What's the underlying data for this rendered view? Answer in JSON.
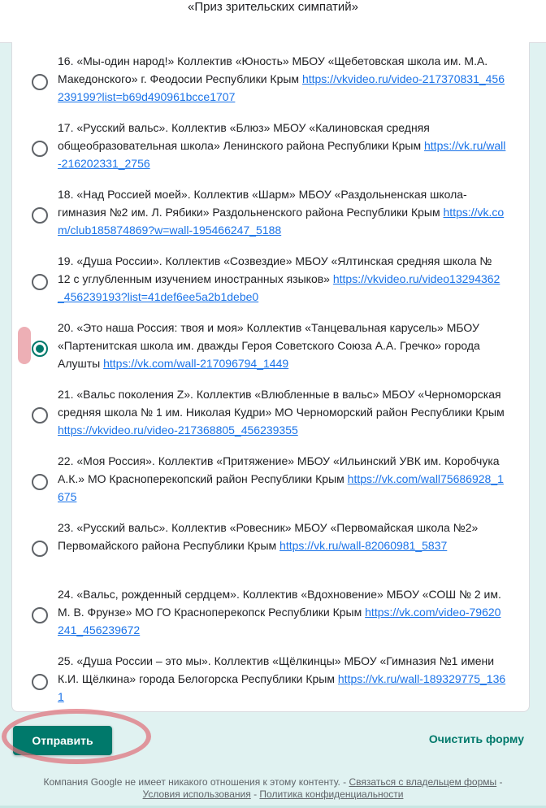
{
  "header": {
    "title": "«Приз зрительских симпатий»"
  },
  "options": [
    {
      "text": "16. «Мы-один народ!» Коллектив «Юность» МБОУ «Щебетовская школа им. М.А. Македонского» г. Феодосии Республики Крым ",
      "link": "https://vkvideo.ru/video-217370831_456239199?list=b69d490961bcce1707",
      "checked": false
    },
    {
      "text": "17. «Русский вальс». Коллектив «Блюз» МБОУ «Калиновская средняя общеобразовательная школа» Ленинского района Республики Крым ",
      "link": "https://vk.ru/wall-216202331_2756",
      "checked": false
    },
    {
      "text": "18. «Над Россией моей». Коллектив «Шарм» МБОУ «Раздольненская школа-гимназия №2 им. Л. Рябики» Раздольненского района Республики Крым ",
      "link": "https://vk.com/club185874869?w=wall-195466247_5188",
      "checked": false
    },
    {
      "text": "19. «Душа России». Коллектив «Созвездие» МБОУ «Ялтинская средняя школа № 12 с углубленным изучением иностранных языков» ",
      "link": "https://vkvideo.ru/video13294362_456239193?list=41def6ee5a2b1debe0",
      "checked": false
    },
    {
      "text": "20. «Это наша Россия: твоя и моя» Коллектив «Танцевальная карусель» МБОУ «Партенитская школа им. дважды Героя Советского Союза А.А. Гречко» города Алушты ",
      "link": "https://vk.com/wall-217096794_1449",
      "checked": true
    },
    {
      "text": "21. «Вальс поколения Z». Коллектив «Влюбленные в вальс» МБОУ «Черноморская средняя школа № 1 им. Николая Кудри» МО Черноморский район Республики Крым ",
      "link": "https://vkvideo.ru/video-217368805_456239355",
      "checked": false
    },
    {
      "text": "22. «Моя Россия». Коллектив «Притяжение» МБОУ «Ильинский УВК им. Коробчука А.К.» МО Красноперекопский район Республики Крым ",
      "link": "https://vk.com/wall75686928_1675",
      "checked": false
    },
    {
      "text": "23. «Русский вальс». Коллектив «Ровесник» МБОУ «Первомайская школа №2» Первомайского района Республики Крым ",
      "link": "https://vk.ru/wall-82060981_5837",
      "checked": false
    },
    {
      "text": "24. «Вальс, рожденный сердцем». Коллектив «Вдохновение» МБОУ «СОШ № 2 им. М. В. Фрунзе» МО ГО Красноперекопск Республики Крым ",
      "link": "https://vk.com/video-79620241_456239672",
      "checked": false
    },
    {
      "text": "25. «Душа России – это мы». Коллектив «Щёлкинцы» МБОУ «Гимназия №1 имени К.И. Щёлкина» города Белогорска Республики Крым ",
      "link": "https://vk.ru/wall-189329775_1361",
      "checked": false
    }
  ],
  "actions": {
    "submit_label": "Отправить",
    "clear_label": "Очистить форму"
  },
  "footer": {
    "disclaimer": "Компания Google не имеет никакого отношения к этому контенту. - ",
    "contact_link": "Связаться с владельцем формы",
    "sep1": " -",
    "terms_link": "Условия использования",
    "sep2": " - ",
    "privacy_link": "Политика конфиденциальности"
  },
  "colors": {
    "accent": "#00796b",
    "background": "#e0f2f1",
    "link": "#1a73e8",
    "annotation": "#de6e78"
  }
}
